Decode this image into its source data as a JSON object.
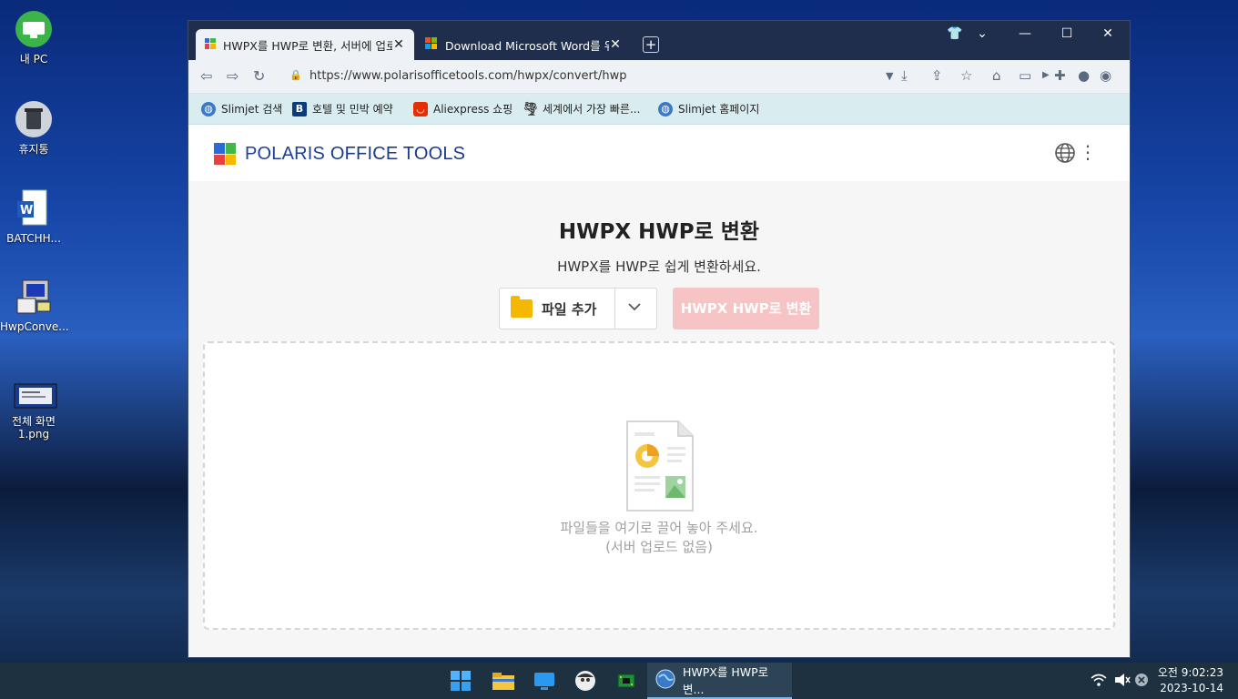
{
  "desktop": {
    "icons": [
      {
        "label": "내 PC"
      },
      {
        "label": "휴지통"
      },
      {
        "label": "BATCHH..."
      },
      {
        "label": "HwpConve..."
      },
      {
        "label": "전체 화면\n1.png"
      }
    ]
  },
  "browser": {
    "tabs": [
      {
        "title": "HWPX를 HWP로 변환, 서버에 업로드",
        "active": true
      },
      {
        "title": "Download Microsoft Word를 위한",
        "active": false
      }
    ],
    "address": "https://www.polarisofficetools.com/hwpx/convert/hwp",
    "bookmarks": [
      {
        "label": "Slimjet 검색"
      },
      {
        "label": "호텔 및 민박 예약"
      },
      {
        "label": "Aliexpress 쇼핑"
      },
      {
        "label": "세계에서 가장 빠른..."
      },
      {
        "label": "Slimjet 홈페이지"
      }
    ]
  },
  "site": {
    "brand_bold": "POLARIS",
    "brand_rest": " OFFICE TOOLS",
    "title": "HWPX HWP로 변환",
    "subtitle": "HWPX를 HWP로 쉽게 변환하세요.",
    "add_file_label": "파일 추가",
    "convert_label": "HWPX HWP로 변환",
    "drop_line1": "파일들을 여기로 끌어 놓아 주세요.",
    "drop_line2": "(서버 업로드 없음)"
  },
  "taskbar": {
    "active_app": "HWPX를 HWP로 변...",
    "time": "오전 9:02:23",
    "date": "2023-10-14"
  },
  "colors": {
    "accent_disabled": "#f6c4c4",
    "brand": "#1a3a8a",
    "tabbar": "#1e2e4c"
  }
}
